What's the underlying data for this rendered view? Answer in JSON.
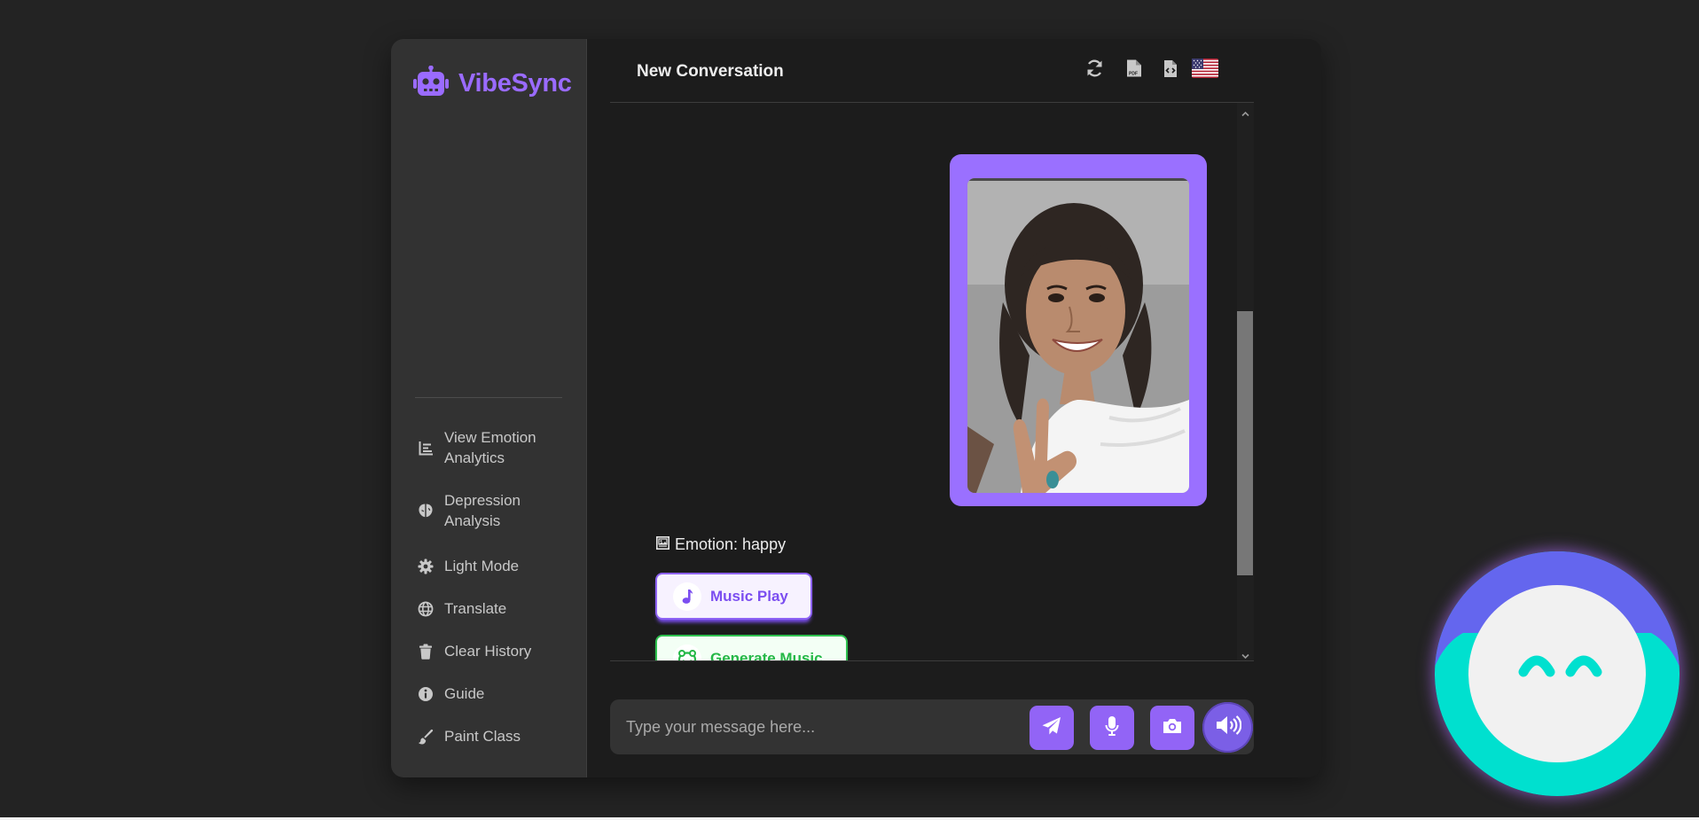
{
  "brand": {
    "name": "VibeSync",
    "icon": "robot-icon"
  },
  "sidebar": {
    "items": [
      {
        "label": "View Emotion Analytics",
        "icon": "chart-icon"
      },
      {
        "label": "Depression Analysis",
        "icon": "brain-icon"
      },
      {
        "label": "Light Mode",
        "icon": "gear-icon"
      },
      {
        "label": "Translate",
        "icon": "globe-icon"
      },
      {
        "label": "Clear History",
        "icon": "trash-icon"
      },
      {
        "label": "Guide",
        "icon": "info-icon"
      },
      {
        "label": "Paint Class",
        "icon": "paintbrush-icon"
      }
    ]
  },
  "header": {
    "title": "New Conversation",
    "actions": [
      {
        "name": "refresh",
        "icon": "refresh-icon"
      },
      {
        "name": "export-pdf",
        "icon": "pdf-file-icon"
      },
      {
        "name": "export-code",
        "icon": "code-file-icon"
      },
      {
        "name": "language",
        "icon": "us-flag-icon"
      }
    ]
  },
  "chat": {
    "photo_alt": "Uploaded selfie",
    "emotion_text": "Emotion: happy",
    "actions": {
      "music_play": "Music Play",
      "generate_music": "Generate Music"
    }
  },
  "composer": {
    "placeholder": "Type your message here...",
    "buttons": [
      "send-icon",
      "microphone-icon",
      "camera-icon",
      "speaker-icon"
    ]
  },
  "colors": {
    "accent": "#9264f6",
    "brand": "#9a6bff",
    "green": "#2fc14f",
    "mascot_teal": "#00e0cf",
    "mascot_blue": "#6466ee"
  }
}
